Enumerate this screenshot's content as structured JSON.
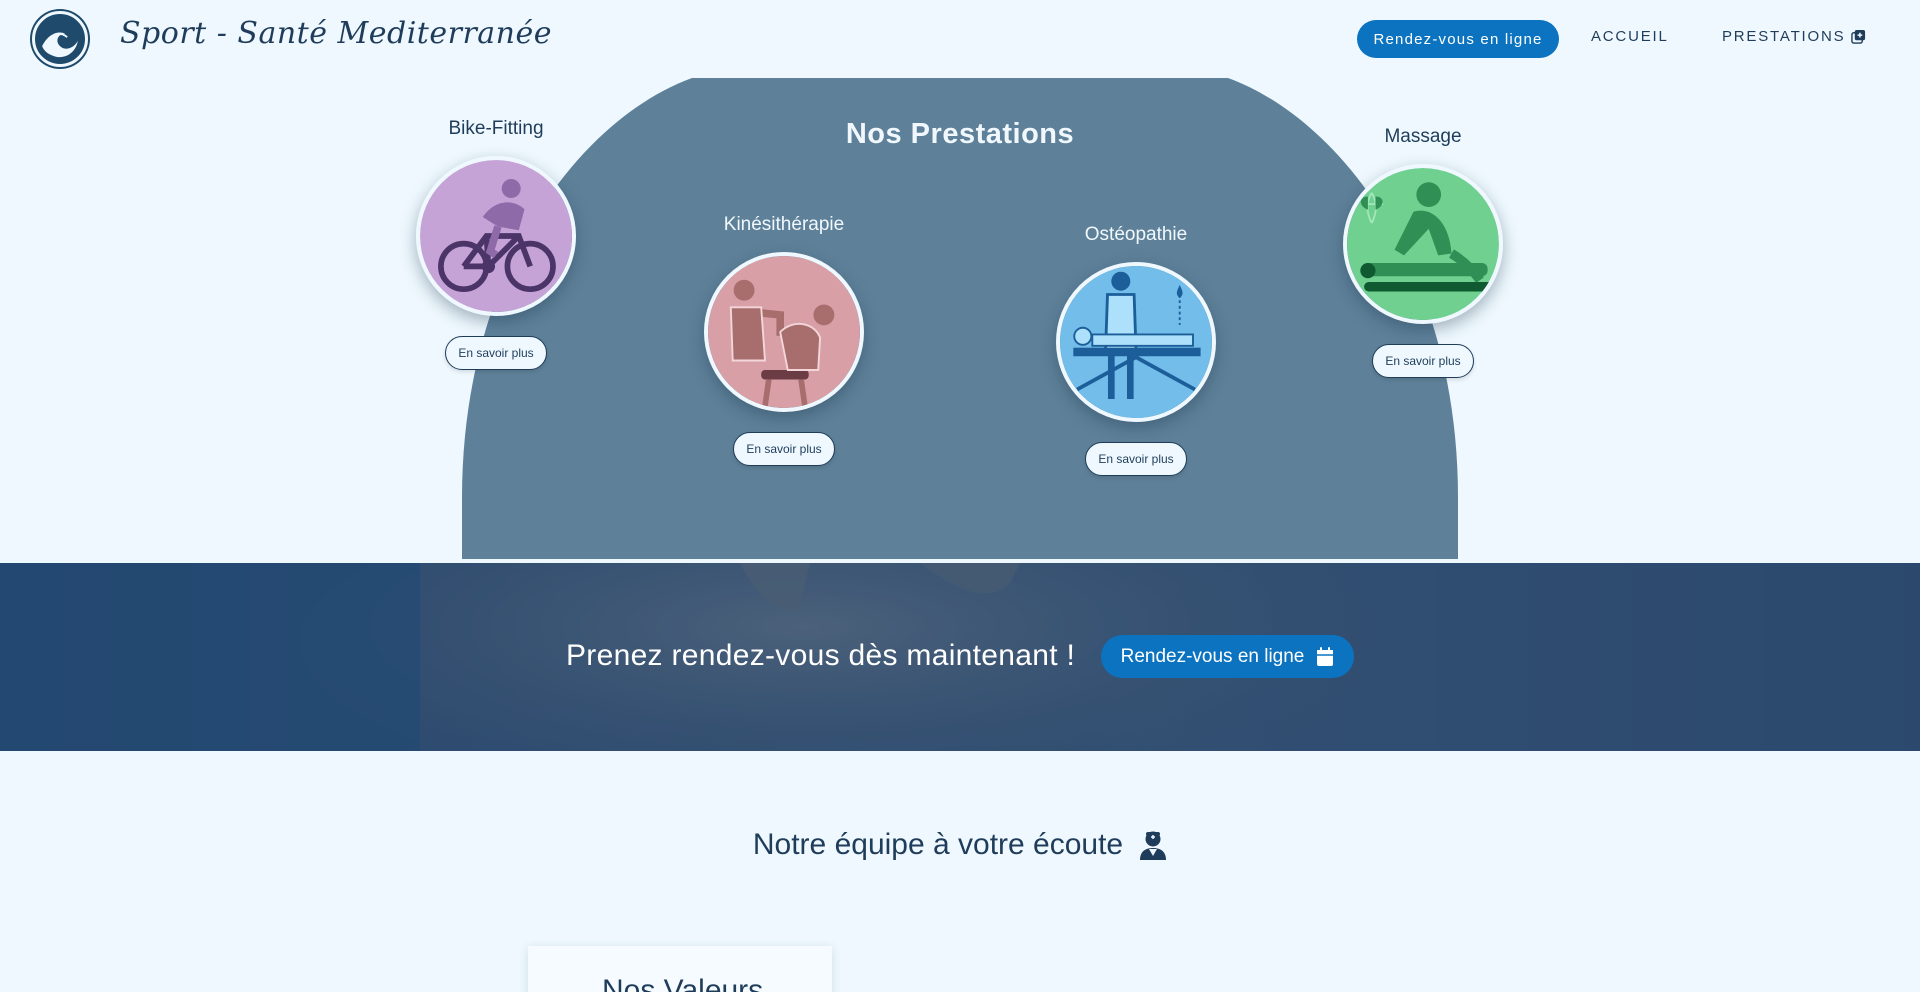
{
  "header": {
    "brand": "Sport - Santé Mediterranée",
    "cta_label": "Rendez-vous en ligne",
    "nav": [
      {
        "label": "ACCUEIL"
      },
      {
        "label": "PRESTATIONS"
      }
    ]
  },
  "services": {
    "title": "Nos Prestations",
    "items": [
      {
        "name": "Bike-Fitting",
        "button": "En savoir plus",
        "icon": "cyclist-icon",
        "color": "#c6a3d6"
      },
      {
        "name": "Kinésithérapie",
        "button": "En savoir plus",
        "icon": "physiotherapy-icon",
        "color": "#d8a0a6"
      },
      {
        "name": "Ostéopathie",
        "button": "En savoir plus",
        "icon": "osteopathy-icon",
        "color": "#72bde9"
      },
      {
        "name": "Massage",
        "button": "En savoir plus",
        "icon": "massage-icon",
        "color": "#6fd08f"
      }
    ]
  },
  "banner": {
    "text": "Prenez rendez-vous dès maintenant !",
    "cta_label": "Rendez-vous en ligne",
    "cta_icon": "calendar-icon"
  },
  "team": {
    "title": "Notre équipe à votre écoute",
    "icon": "doctor-icon"
  },
  "values": {
    "title": "Nos Valeurs"
  },
  "colors": {
    "background": "#eef8fe",
    "accent": "#0b73c0",
    "arch": "#5e8199",
    "text": "#1f3d5a"
  }
}
